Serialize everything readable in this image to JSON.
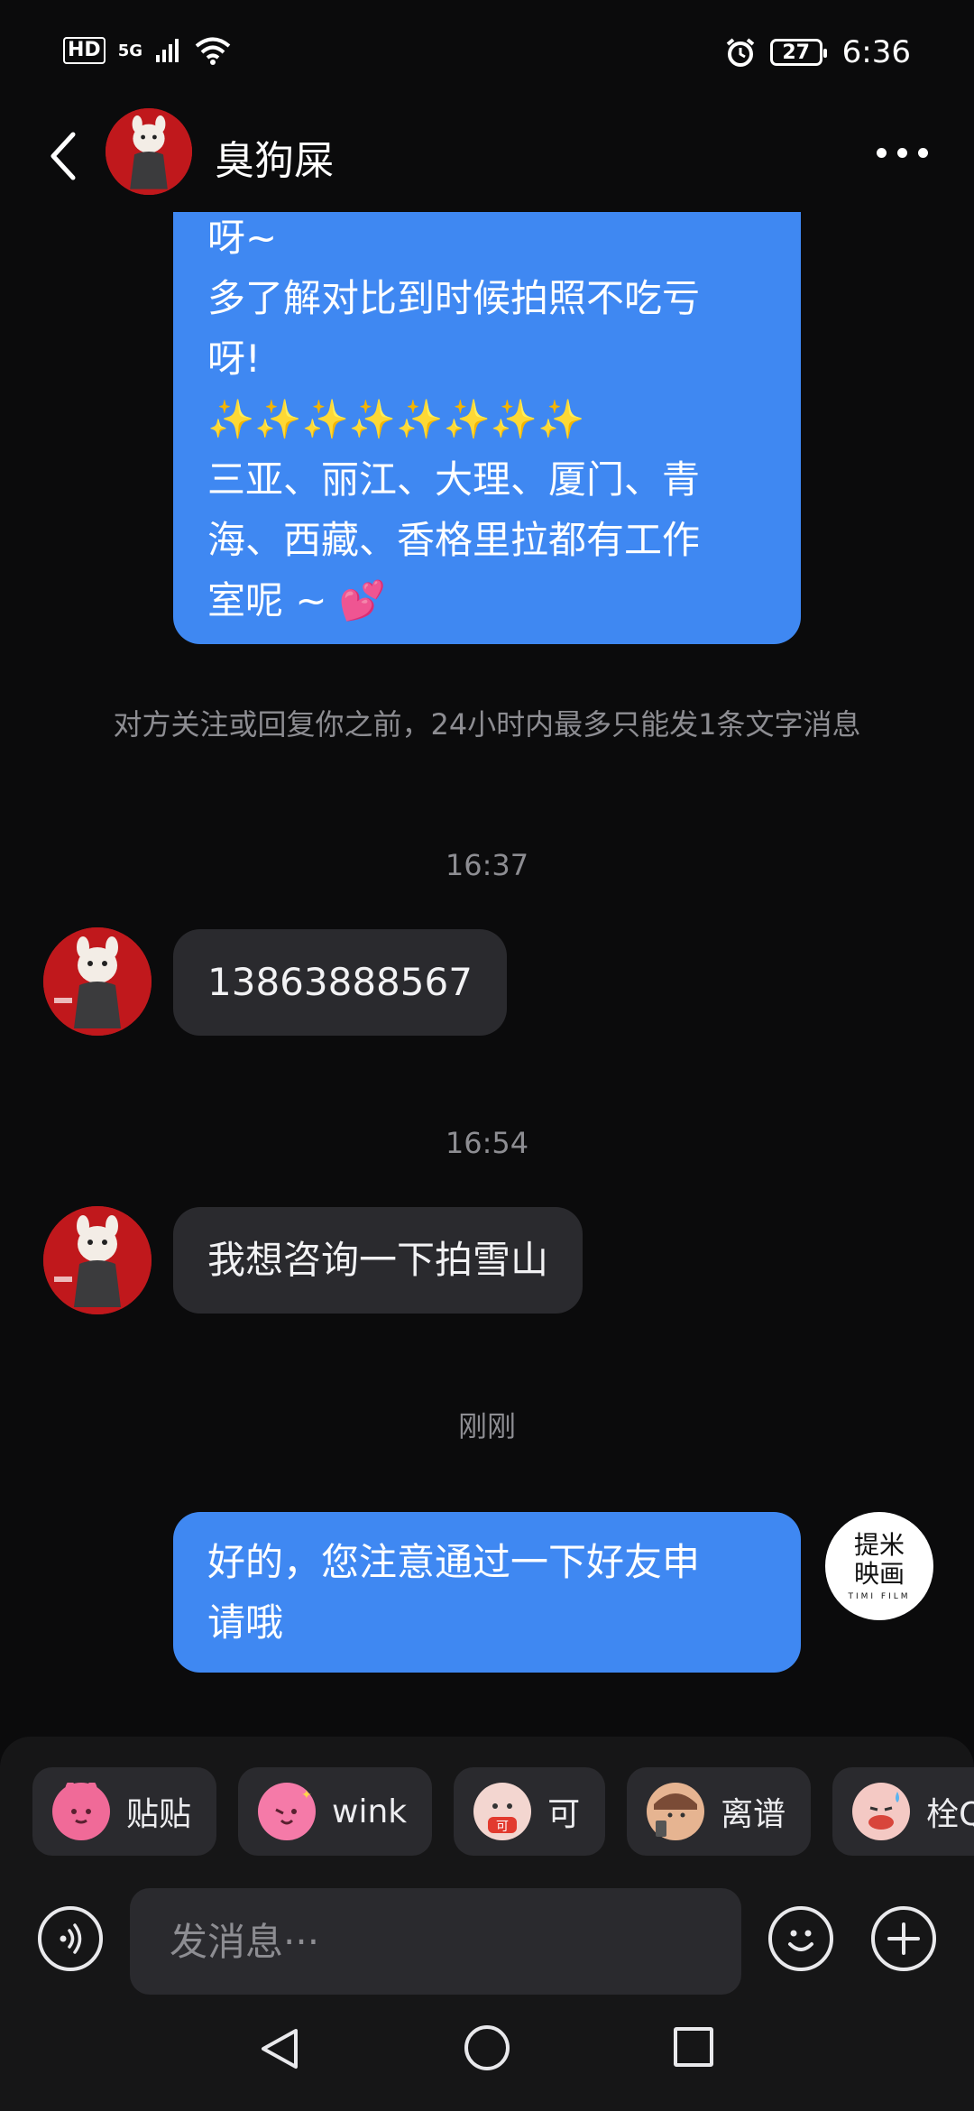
{
  "status_bar": {
    "hd": "HD",
    "network": "5G",
    "battery": "27",
    "time": "6:36"
  },
  "header": {
    "contact_name": "臭狗屎"
  },
  "messages": {
    "m1": {
      "lines": [
        "呀~",
        "多了解对比到时候拍照不吃亏",
        "呀!",
        "✨✨✨✨✨✨✨✨",
        "三亚、丽江、大理、厦门、青",
        "海、西藏、香格里拉都有工作",
        "室呢 ~ 💕"
      ]
    },
    "system_note": "对方关注或回复你之前，24小时内最多只能发1条文字消息",
    "ts1": "16:37",
    "m2": "13863888567",
    "ts2": "16:54",
    "m3": "我想咨询一下拍雪山",
    "ts3": "刚刚",
    "m4": {
      "lines": [
        "好的，您注意通过一下好友申",
        "请哦"
      ]
    },
    "own_avatar_logo": {
      "line1": "提米",
      "line2": "映画",
      "line3": "TIMI FILM"
    }
  },
  "sticker_suggestions": [
    {
      "label": "贴贴",
      "icon": "pink-bunny-hug-sticker",
      "color": "#f06a98"
    },
    {
      "label": "wink",
      "icon": "pink-bunny-wink-sticker",
      "color": "#f57aa8"
    },
    {
      "label": "可",
      "icon": "red-okay-sticker",
      "color": "#f3d6d0"
    },
    {
      "label": "离谱",
      "icon": "girl-phone-sticker",
      "color": "#e6b491"
    },
    {
      "label": "栓Q",
      "icon": "thank-you-sticker",
      "color": "#f4c9c4"
    }
  ],
  "input": {
    "placeholder": "发消息···"
  },
  "colors": {
    "background": "#0b0b0c",
    "outgoing_bubble": "#3f88f2",
    "incoming_bubble": "#2a2a2e",
    "muted_text": "#8d8d92",
    "avatar_red": "#c0181c"
  }
}
